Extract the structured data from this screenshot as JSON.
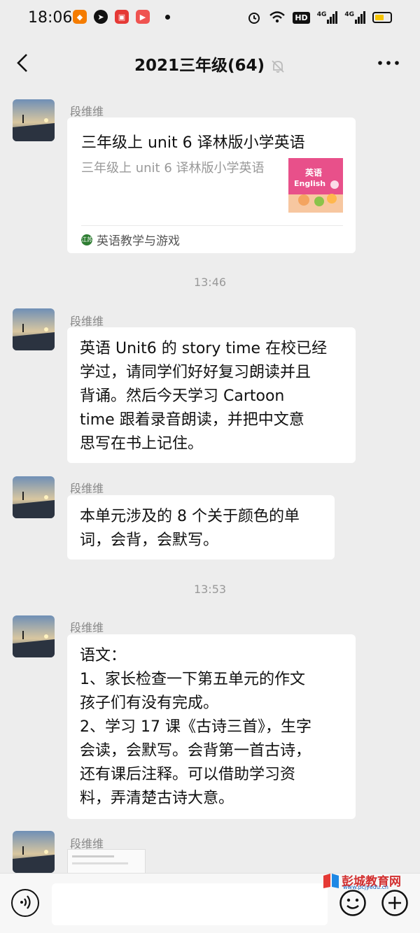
{
  "status_bar": {
    "time": "18:06",
    "network_badge": "HD",
    "signal1_label": "4G",
    "signal2_label": "4G"
  },
  "header": {
    "title": "2021三年级(64)"
  },
  "messages": [
    {
      "sender": "段维维",
      "type": "card",
      "card_title": "三年级上 unit 6 译林版小学英语",
      "card_desc": "三年级上 unit 6 译林版小学英语",
      "thumb_text_top": "英语",
      "thumb_text_bottom": "English",
      "source": "英语教学与游戏",
      "source_icon_text": "江苏"
    },
    {
      "timestamp": "13:46"
    },
    {
      "sender": "段维维",
      "type": "text",
      "lines": [
        "英语 Unit6 的 story time 在校已经",
        "学过，请同学们好好复习朗读并且",
        "背诵。然后今天学习 Cartoon",
        "time 跟着录音朗读，并把中文意",
        "思写在书上记住。"
      ]
    },
    {
      "sender": "段维维",
      "type": "text",
      "lines": [
        "本单元涉及的 8 个关于颜色的单",
        "词，会背，会默写。"
      ]
    },
    {
      "timestamp": "13:53"
    },
    {
      "sender": "段维维",
      "type": "text",
      "lines": [
        "语文：",
        "1、家长检查一下第五单元的作文",
        "孩子们有没有完成。",
        "2、学习 17 课《古诗三首》，生字",
        "会读，会默写。会背第一首古诗，",
        "还有课后注释。可以借助学习资",
        "料，弄清楚古诗大意。"
      ]
    },
    {
      "sender": "段维维",
      "type": "image"
    }
  ],
  "watermark": {
    "text": "彭城教育网",
    "sub": "www.pcjyedu.cn"
  },
  "colors": {
    "background": "#ededed",
    "bubble": "#ffffff",
    "timestamp": "#999999"
  }
}
